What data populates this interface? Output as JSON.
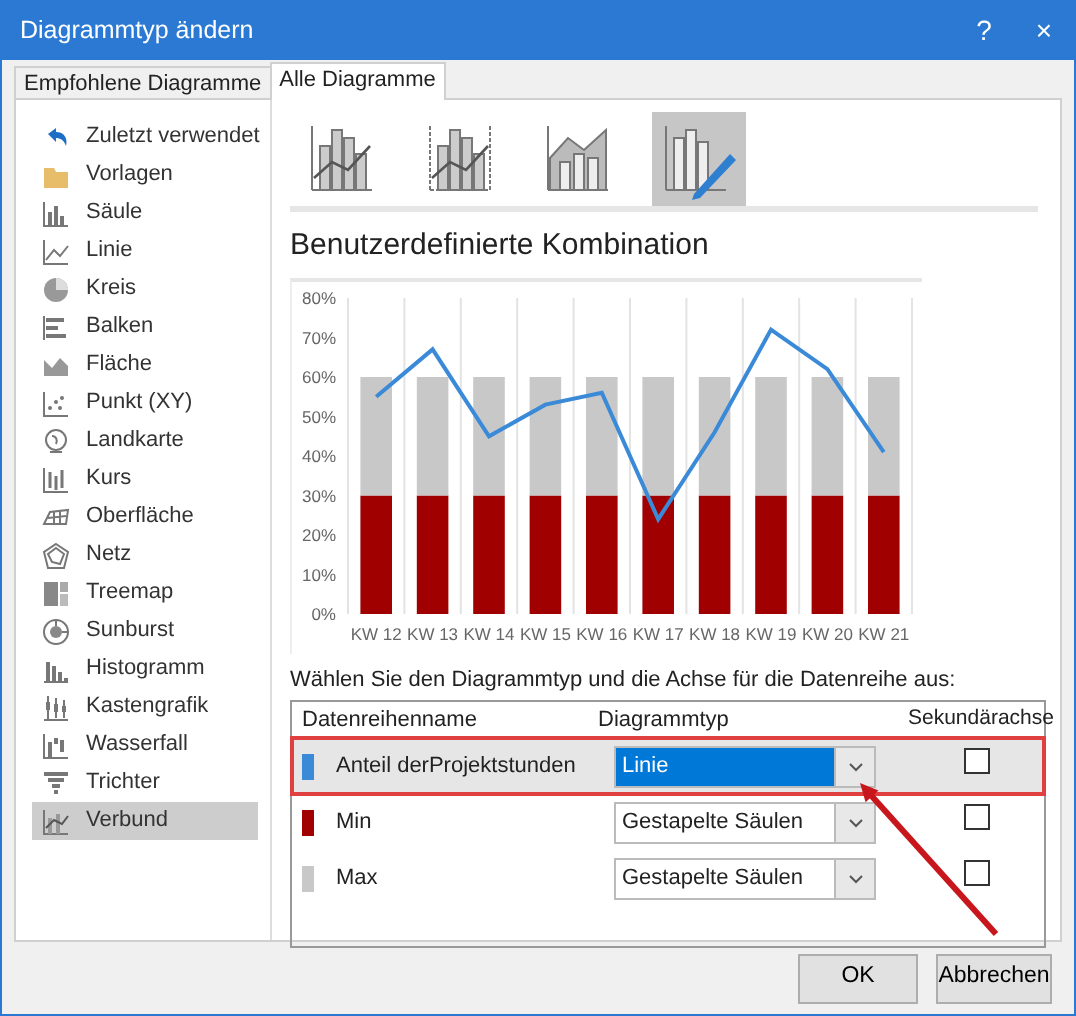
{
  "window": {
    "title": "Diagrammtyp ändern",
    "help": "?",
    "close": "×"
  },
  "tabs": [
    {
      "label": "Empfohlene Diagramme",
      "selected": false
    },
    {
      "label": "Alle Diagramme",
      "selected": true
    }
  ],
  "sidebar": {
    "items": [
      {
        "label": "Zuletzt verwendet",
        "selected": false
      },
      {
        "label": "Vorlagen",
        "selected": false
      },
      {
        "label": "Säule",
        "selected": false
      },
      {
        "label": "Linie",
        "selected": false
      },
      {
        "label": "Kreis",
        "selected": false
      },
      {
        "label": "Balken",
        "selected": false
      },
      {
        "label": "Fläche",
        "selected": false
      },
      {
        "label": "Punkt (XY)",
        "selected": false
      },
      {
        "label": "Landkarte",
        "selected": false
      },
      {
        "label": "Kurs",
        "selected": false
      },
      {
        "label": "Oberfläche",
        "selected": false
      },
      {
        "label": "Netz",
        "selected": false
      },
      {
        "label": "Treemap",
        "selected": false
      },
      {
        "label": "Sunburst",
        "selected": false
      },
      {
        "label": "Histogramm",
        "selected": false
      },
      {
        "label": "Kastengrafik",
        "selected": false
      },
      {
        "label": "Wasserfall",
        "selected": false
      },
      {
        "label": "Trichter",
        "selected": false
      },
      {
        "label": "Verbund",
        "selected": true
      }
    ]
  },
  "subtypes": [
    {
      "selected": false
    },
    {
      "selected": false
    },
    {
      "selected": false
    },
    {
      "selected": true
    }
  ],
  "heading": "Benutzerdefinierte Kombination",
  "chart_data": {
    "type": "bar",
    "stacked": true,
    "categories": [
      "KW 12",
      "KW 13",
      "KW 14",
      "KW 15",
      "KW 16",
      "KW 17",
      "KW 18",
      "KW 19",
      "KW 20",
      "KW 21"
    ],
    "ylim": [
      0,
      80
    ],
    "yticks": [
      {
        "value": 0,
        "label": "0%"
      },
      {
        "value": 10,
        "label": "10%"
      },
      {
        "value": 20,
        "label": "20%"
      },
      {
        "value": 30,
        "label": "30%"
      },
      {
        "value": 40,
        "label": "40%"
      },
      {
        "value": 50,
        "label": "50%"
      },
      {
        "value": 60,
        "label": "60%"
      },
      {
        "value": 70,
        "label": "70%"
      },
      {
        "value": 80,
        "label": "80%"
      }
    ],
    "series": [
      {
        "type": "line",
        "color": "#3a8ad8",
        "values": [
          55,
          67,
          45,
          53,
          56,
          24,
          46,
          72,
          62,
          41
        ]
      },
      {
        "type": "bar",
        "color": "#a00000",
        "values": [
          30,
          30,
          30,
          30,
          30,
          30,
          30,
          30,
          30,
          30
        ]
      },
      {
        "type": "bar",
        "color": "#c8c8c8",
        "values": [
          30,
          30,
          30,
          30,
          30,
          30,
          30,
          30,
          30,
          30
        ]
      }
    ]
  },
  "series_prompt": "Wählen Sie den Diagrammtyp und die Achse für die Datenreihe aus:",
  "table": {
    "columns": [
      "Datenreihenname",
      "Diagrammtyp",
      "Sekundärachse"
    ],
    "rows": [
      {
        "name": "Anteil derProjektstunden",
        "color": "#3a8ad8",
        "chart_type": "Linie",
        "secondary_axis": false,
        "selected": true,
        "highlighted": true
      },
      {
        "name": "Min",
        "color": "#a00000",
        "chart_type": "Gestapelte Säulen",
        "secondary_axis": false,
        "selected": false,
        "highlighted": false
      },
      {
        "name": "Max",
        "color": "#c8c8c8",
        "chart_type": "Gestapelte Säulen",
        "secondary_axis": false,
        "selected": false,
        "highlighted": false
      }
    ]
  },
  "buttons": [
    "OK",
    "Abbrechen"
  ]
}
